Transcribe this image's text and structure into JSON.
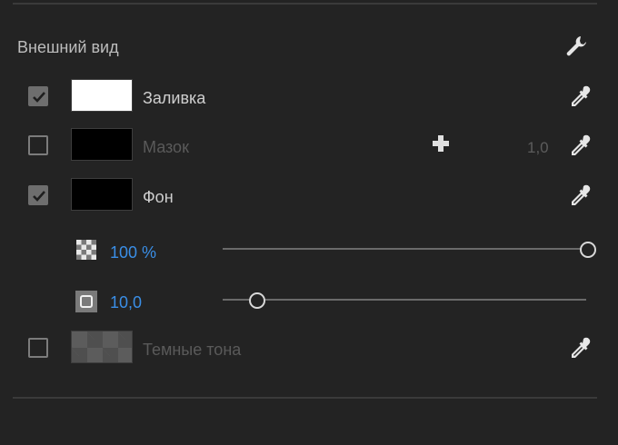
{
  "section": {
    "title": "Внешний вид",
    "settings_icon": "wrench-icon"
  },
  "rows": {
    "fill": {
      "label": "Заливка",
      "checked": true,
      "swatch": "#ffffff",
      "picker_icon": "eyedropper-icon"
    },
    "stroke": {
      "label": "Мазок",
      "checked": false,
      "swatch": "#000000",
      "add_icon": "plus-icon",
      "width_value": "1,0",
      "picker_icon": "eyedropper-icon"
    },
    "background": {
      "label": "Фон",
      "checked": true,
      "swatch": "#000000",
      "picker_icon": "eyedropper-icon"
    },
    "background_opacity": {
      "value_text": "100 %",
      "icon": "checkerboard-opacity-icon",
      "level": 1.0
    },
    "background_size": {
      "value_text": "10,0",
      "icon": "rounded-square-icon",
      "level": 0.1
    },
    "shadow": {
      "label": "Темные тона",
      "checked": false,
      "swatch": "checkerboard",
      "picker_icon": "eyedropper-icon"
    }
  },
  "colors": {
    "background": "#232323",
    "accent_value": "#3a8ee6",
    "label_active": "#cfcfcf",
    "label_disabled": "#5a5a5a"
  }
}
